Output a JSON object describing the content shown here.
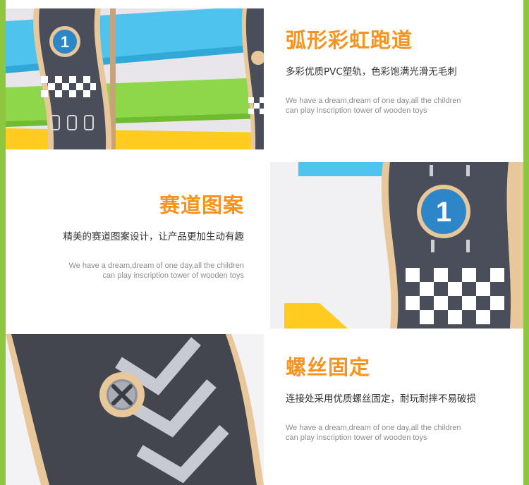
{
  "sections": [
    {
      "title": "弧形彩虹跑道",
      "description": "多彩优质PVC塑轨，色彩饱满光滑无毛刺",
      "english_line1": "We have a dream,dream of one day,all the children",
      "english_line2": "can play inscription tower of wooden toys"
    },
    {
      "title": "赛道图案",
      "description": "精美的赛道图案设计，让产品更加生动有趣",
      "english_line1": "We have a dream,dream of one day,all the children",
      "english_line2": "can play inscription tower of wooden toys"
    },
    {
      "title": "螺丝固定",
      "description": "连接处采用优质螺丝固定，耐玩耐摔不易破损",
      "english_line1": "We have a dream,dream of one day,all the children",
      "english_line2": "can play inscription tower of wooden toys"
    }
  ],
  "photos": {
    "track_number": "1"
  },
  "colors": {
    "accent": "#f7931e",
    "border_green": "#8dc63f",
    "track_blue": "#4ec3ee",
    "track_green": "#8ed64a",
    "track_yellow": "#ffcc1f",
    "road_dark": "#4a4d5a"
  }
}
